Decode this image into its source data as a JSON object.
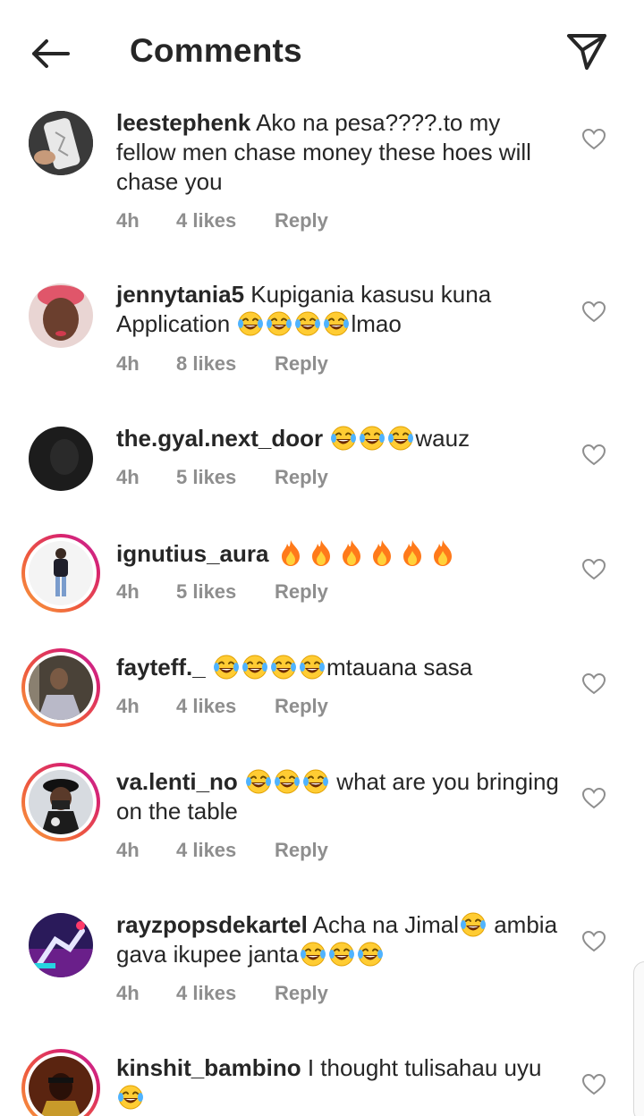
{
  "header": {
    "title": "Comments",
    "back_icon": "arrow-left-icon",
    "send_icon": "paper-plane-icon"
  },
  "colors": {
    "text": "#262626",
    "meta": "#8e8e8e",
    "story_ring_start": "#f9a03c",
    "story_ring_end": "#c32aa3"
  },
  "comments": [
    {
      "username": "leestephenk",
      "text": "Ako na pesa????.to my fellow men chase money these hoes will chase you",
      "time": "4h",
      "likes": "4 likes",
      "reply": "Reply",
      "story_ring": false
    },
    {
      "username": "jennytania5",
      "text": "Kupigania kasusu kuna Application",
      "text_emoji": "😂😂😂😂",
      "text_after": "lmao",
      "time": "4h",
      "likes": "8 likes",
      "reply": "Reply",
      "story_ring": false
    },
    {
      "username": "the.gyal.next_door",
      "text_emoji": "😂😂😂",
      "text_after": "wauz",
      "time": "4h",
      "likes": "5 likes",
      "reply": "Reply",
      "story_ring": false
    },
    {
      "username": "ignutius_aura",
      "text_emoji": "🔥🔥🔥🔥🔥🔥",
      "time": "4h",
      "likes": "5 likes",
      "reply": "Reply",
      "story_ring": true
    },
    {
      "username": "fayteff._",
      "text_emoji": "😂😂😂😂",
      "text_after": "mtauana sasa",
      "time": "4h",
      "likes": "4 likes",
      "reply": "Reply",
      "story_ring": true
    },
    {
      "username": "va.lenti_no",
      "text_emoji": "😂😂😂",
      "text_after": " what are you bringing on the table",
      "time": "4h",
      "likes": "4 likes",
      "reply": "Reply",
      "story_ring": true
    },
    {
      "username": "rayzpopsdekartel",
      "text": "Acha na Jimal",
      "text_emoji": "😂",
      "text_mid": "ambia gava  ikupee janta",
      "text_emoji2": "😂😂😂",
      "time": "4h",
      "likes": "4 likes",
      "reply": "Reply",
      "story_ring": false
    },
    {
      "username": "kinshit_bambino",
      "text": "I thought tulisahau uyu",
      "text_emoji": "😂",
      "story_ring": true
    }
  ],
  "icons": {
    "heart": "heart-outline-icon",
    "laugh": "face-with-tears-of-joy-icon",
    "fire": "fire-icon"
  }
}
